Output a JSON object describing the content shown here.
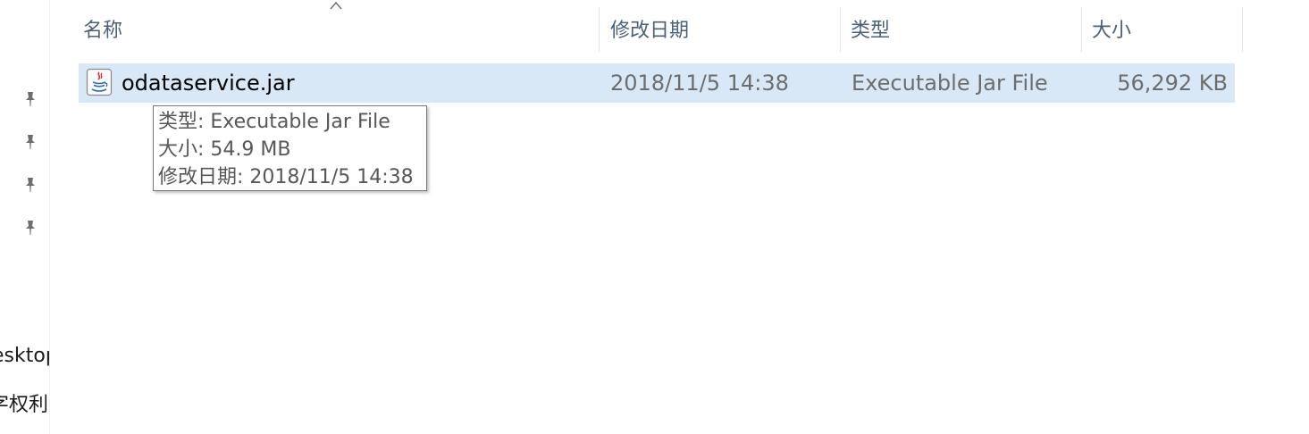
{
  "nav": {
    "items": [
      {
        "label": "esktop"
      },
      {
        "label": "字权利"
      }
    ]
  },
  "columns": {
    "name": "名称",
    "modified": "修改日期",
    "type": "类型",
    "size": "大小"
  },
  "file": {
    "name": "odataservice.jar",
    "modified": "2018/11/5 14:38",
    "type": "Executable Jar File",
    "size": "56,292 KB"
  },
  "tooltip": {
    "type_line": "类型: Executable Jar File",
    "size_line": "大小: 54.9 MB",
    "modified_line": "修改日期: 2018/11/5 14:38"
  },
  "colors": {
    "selection": "#d9e8f7",
    "header_text": "#4c607a",
    "detail_text": "#6d6d6d"
  }
}
